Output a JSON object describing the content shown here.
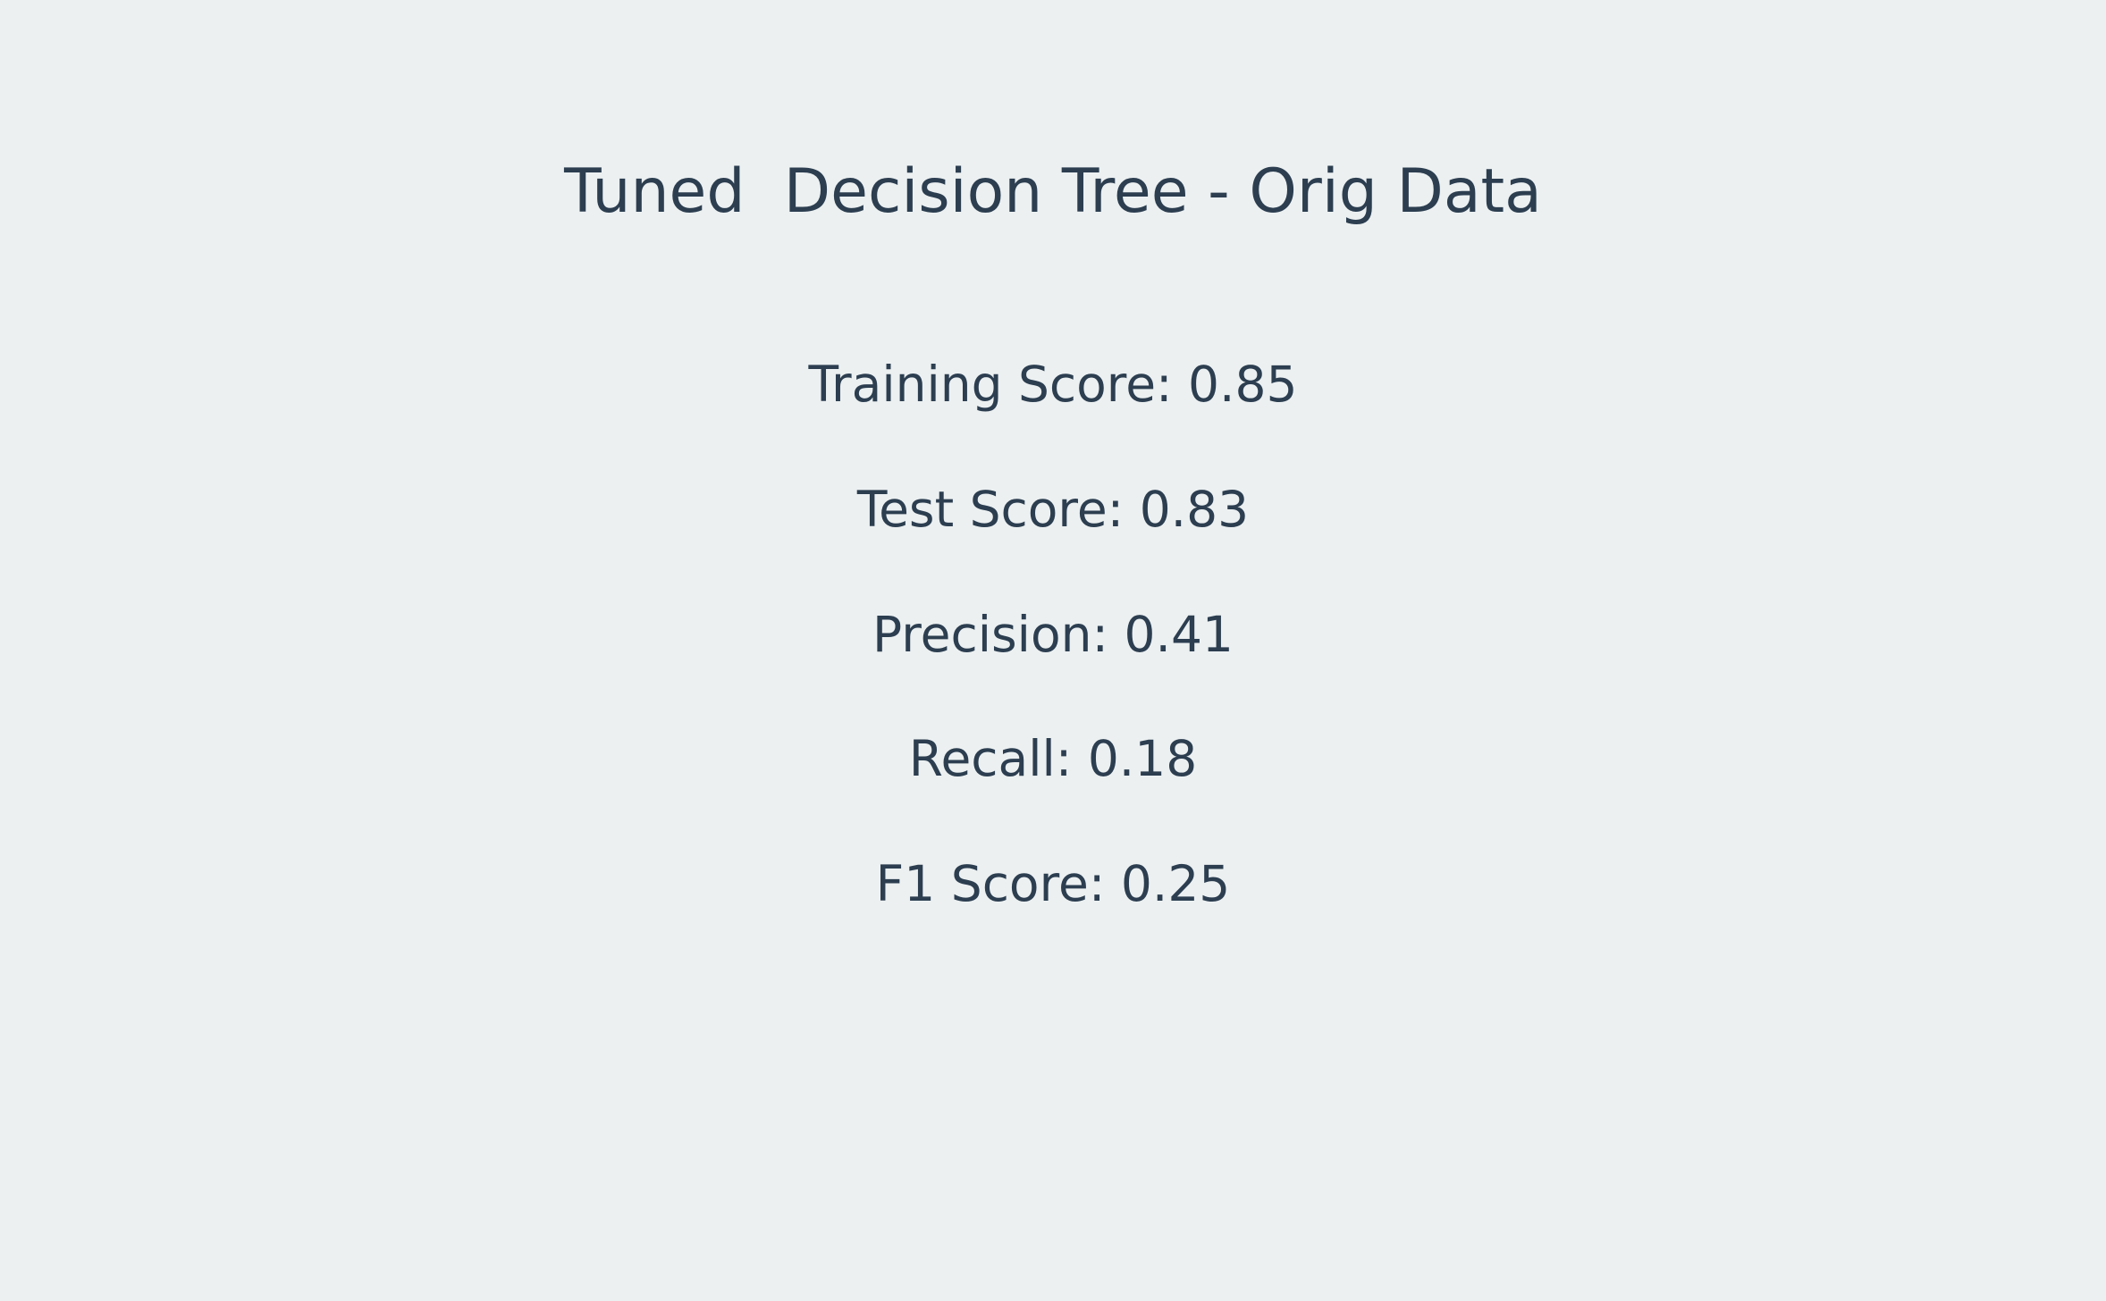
{
  "chart_data": {
    "type": "table",
    "title": "Tuned  Decision Tree - Orig Data",
    "metrics": [
      {
        "label": "Training Score",
        "value": 0.85,
        "text": "Training Score: 0.85"
      },
      {
        "label": "Test Score",
        "value": 0.83,
        "text": "Test Score: 0.83"
      },
      {
        "label": "Precision",
        "value": 0.41,
        "text": "Precision: 0.41"
      },
      {
        "label": "Recall",
        "value": 0.18,
        "text": "Recall: 0.18"
      },
      {
        "label": "F1 Score",
        "value": 0.25,
        "text": "F1 Score: 0.25"
      }
    ]
  },
  "colors": {
    "background": "#ecf0f1",
    "text": "#2c3e50"
  }
}
